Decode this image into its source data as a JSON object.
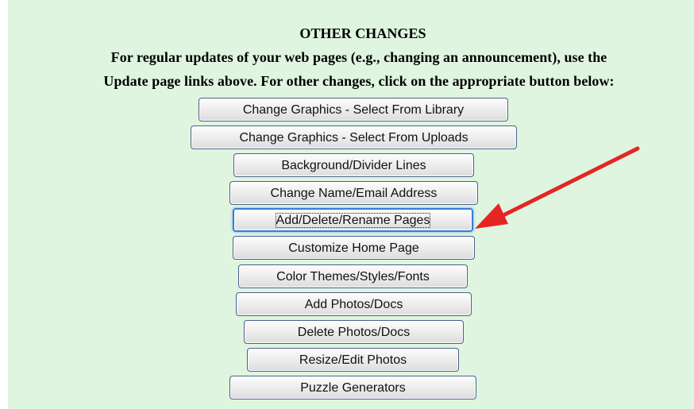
{
  "heading": {
    "title": "OTHER CHANGES",
    "line1": "For regular updates of your web pages (e.g., changing an announcement), use the",
    "line2": "Update page links above. For other changes, click on the appropriate button below:"
  },
  "buttons": [
    {
      "label": "Change Graphics - Select From Library"
    },
    {
      "label": "Change Graphics - Select From Uploads"
    },
    {
      "label": "Background/Divider Lines"
    },
    {
      "label": "Change Name/Email Address"
    },
    {
      "label": "Add/Delete/Rename Pages"
    },
    {
      "label": "Customize Home Page"
    },
    {
      "label": "Color Themes/Styles/Fonts"
    },
    {
      "label": "Add Photos/Docs"
    },
    {
      "label": "Delete Photos/Docs"
    },
    {
      "label": "Resize/Edit Photos"
    },
    {
      "label": "Puzzle Generators"
    }
  ],
  "annotation": {
    "arrow_color": "#e52521"
  }
}
